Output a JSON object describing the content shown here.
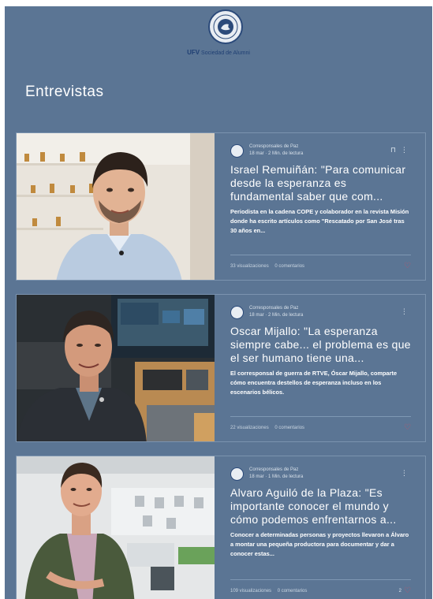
{
  "header": {
    "logo_text": "CORRESPONSALES DE PAZ",
    "brand_bold": "UFV",
    "brand_rest": "Sociedad de Alumni"
  },
  "section": {
    "title": "Entrevistas"
  },
  "posts": [
    {
      "author": "Corresponsales de Paz",
      "date": "18 mar",
      "read_time": "2 Min. de lectura",
      "title": "Israel Remuiñán: \"Para comunicar desde la esperanza es fundamental saber que com...",
      "excerpt": "Periodista en la cadena COPE y colaborador en la revista Misión donde ha escrito artículos como \"Rescatado por San José tras 30 años en...",
      "views": "33 visualizaciones",
      "comments": "0 comentarios",
      "likes": ""
    },
    {
      "author": "Corresponsales de Paz",
      "date": "18 mar",
      "read_time": "2 Min. de lectura",
      "title": "Oscar Mijallo: \"La esperanza siempre cabe... el problema es que el ser humano tiene una...",
      "excerpt": "El corresponsal de guerra de RTVE, Óscar Mijallo, comparte cómo encuentra destellos de esperanza incluso en los escenarios bélicos.",
      "views": "22 visualizaciones",
      "comments": "0 comentarios",
      "likes": ""
    },
    {
      "author": "Corresponsales de Paz",
      "date": "18 mar",
      "read_time": "1 Min. de lectura",
      "title": "Alvaro Aguiló de la Plaza: \"Es importante conocer el mundo y cómo podemos enfrentarnos a...",
      "excerpt": "Conocer a determinadas personas y proyectos llevaron a Álvaro a montar una pequeña productora para documentar y dar a conocer estas...",
      "views": "109 visualizaciones",
      "comments": "0 comentarios",
      "likes": "2"
    }
  ],
  "colors": {
    "background": "#5b7594",
    "heart": "#c0546a",
    "brand": "#1f3f73"
  }
}
